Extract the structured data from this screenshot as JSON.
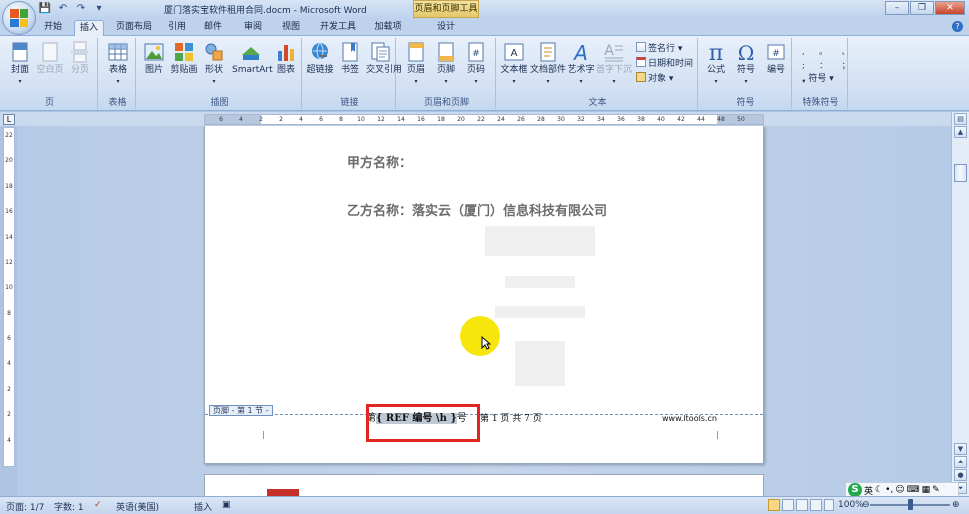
{
  "window": {
    "title": "厦门落实宝软件租用合同.docm - Microsoft Word",
    "context_tab_title": "页眉和页脚工具",
    "controls": {
      "minimize": "–",
      "restore": "❐",
      "close": "✕"
    }
  },
  "tabs": [
    "开始",
    "插入",
    "页面布局",
    "引用",
    "邮件",
    "审阅",
    "视图",
    "开发工具",
    "加载项",
    "设计"
  ],
  "active_tab": "插入",
  "ribbon": {
    "groups": {
      "pages": {
        "label": "页",
        "buttons": [
          "封面",
          "空白页",
          "分页"
        ]
      },
      "tables": {
        "label": "表格",
        "buttons": [
          "表格"
        ]
      },
      "illustrations": {
        "label": "插图",
        "buttons": [
          "图片",
          "剪贴画",
          "形状",
          "SmartArt",
          "图表"
        ]
      },
      "links": {
        "label": "链接",
        "buttons": [
          "超链接",
          "书签",
          "交叉引用"
        ]
      },
      "header_footer": {
        "label": "页眉和页脚",
        "buttons": [
          "页眉",
          "页脚",
          "页码"
        ]
      },
      "text": {
        "label": "文本",
        "buttons": [
          "文本框",
          "文档部件",
          "艺术字",
          "首字下沉"
        ],
        "small": [
          "签名行",
          "日期和时间",
          "对象"
        ]
      },
      "symbols": {
        "label": "符号",
        "buttons": [
          "公式",
          "符号",
          "编号"
        ]
      },
      "special": {
        "label": "特殊符号",
        "small": [
          "符号"
        ]
      }
    }
  },
  "ruler": {
    "ticks": [
      "6",
      "4",
      "2",
      "2",
      "4",
      "6",
      "8",
      "10",
      "12",
      "14",
      "16",
      "18",
      "20",
      "22",
      "24",
      "26",
      "28",
      "30",
      "32",
      "34",
      "36",
      "38",
      "40",
      "42",
      "44",
      "48",
      "50"
    ],
    "vticks": [
      "22",
      "20",
      "18",
      "16",
      "14",
      "12",
      "10",
      "8",
      "6",
      "4",
      "2",
      "2",
      "4"
    ]
  },
  "document": {
    "party_a": "甲方名称：",
    "party_b": "乙方名称：落实云（厦门）信息科技有限公司",
    "footer_tag": "页脚 - 第 1 节 -",
    "footer_prefix": "第",
    "footer_field_open": "{",
    "footer_field_code": " REF 编号 \\h ",
    "footer_field_close": "}",
    "footer_suffix": "号",
    "footer_pages": "第 1 页 共 7 页",
    "footer_url": "www.ltools.cn"
  },
  "statusbar": {
    "page": "页面: 1/7",
    "words": "字数: 1",
    "language": "英语(美国)",
    "mode": "插入",
    "zoom": "100%"
  },
  "ime": {
    "logo": "S",
    "lang": "英"
  },
  "colors": {
    "field_highlight_box": "#e0261f",
    "cursor_highlight": "#f6e60e"
  }
}
